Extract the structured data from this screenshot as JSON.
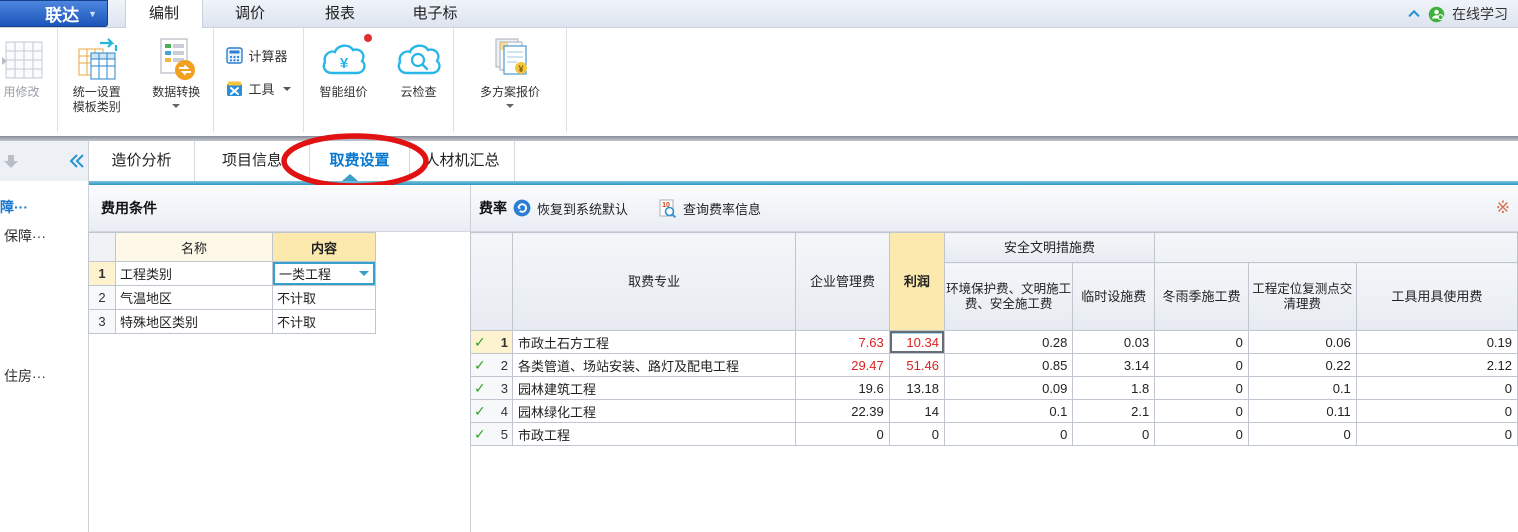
{
  "window": {
    "logo_text": "联达",
    "logo_caret": "▼",
    "menu": [
      {
        "label": "编制",
        "active": true
      },
      {
        "label": "调价"
      },
      {
        "label": "报表"
      },
      {
        "label": "电子标"
      }
    ],
    "online_learning": "在线学习"
  },
  "ribbon": {
    "apply_edit": "用修改",
    "unify_line1": "统一设置",
    "unify_line2": "模板类别",
    "data_convert": "数据转换",
    "calculator": "计算器",
    "tools": "工具",
    "smart_pricing": "智能组价",
    "cloud_check": "云检查",
    "multi_quote": "多方案报价"
  },
  "tabs": {
    "items": [
      {
        "label": "造价分析"
      },
      {
        "label": "项目信息"
      },
      {
        "label": "取费设置",
        "active": true
      },
      {
        "label": "人材机汇总"
      }
    ]
  },
  "sidebar": {
    "items": [
      {
        "label": "障···",
        "active": true
      },
      {
        "label": "保障···"
      },
      {
        "label": "住房···"
      }
    ]
  },
  "cost_conditions": {
    "title": "费用条件",
    "columns": {
      "name": "名称",
      "content": "内容"
    },
    "rows": [
      {
        "num": "1",
        "name": "工程类别",
        "value": "一类工程",
        "editor": "dropdown",
        "selected": true
      },
      {
        "num": "2",
        "name": "气温地区",
        "value": "不计取"
      },
      {
        "num": "3",
        "name": "特殊地区类别",
        "value": "不计取"
      }
    ]
  },
  "rates": {
    "title": "费率",
    "toolbar": {
      "restore": "恢复到系统默认",
      "query": "查询费率信息",
      "corner_icon": "※"
    },
    "check_glyph": "✓",
    "columns": {
      "profession": "取费专业",
      "management": "企业管理费",
      "profit": "利润",
      "safety_group": "安全文明措施费",
      "env_civil": "环境保护费、文明施工费、安全施工费",
      "temp_facility": "临时设施费",
      "winter": "冬雨季施工费",
      "survey_clear": "工程定位复测点交清理费",
      "tool_use": "工具用具使用费"
    },
    "rows": [
      {
        "num": "1",
        "name": "市政土石方工程",
        "values": [
          "7.63",
          "10.34",
          "0.28",
          "0.03",
          "0",
          "0.06",
          "0.19"
        ],
        "red": [
          0,
          1
        ],
        "selected": true,
        "selected_cell": 1
      },
      {
        "num": "2",
        "name": "各类管道、场站安装、路灯及配电工程",
        "values": [
          "29.47",
          "51.46",
          "0.85",
          "3.14",
          "0",
          "0.22",
          "2.12"
        ],
        "red": [
          0,
          1
        ]
      },
      {
        "num": "3",
        "name": "园林建筑工程",
        "values": [
          "19.6",
          "13.18",
          "0.09",
          "1.8",
          "0",
          "0.1",
          "0"
        ],
        "red": []
      },
      {
        "num": "4",
        "name": "园林绿化工程",
        "values": [
          "22.39",
          "14",
          "0.1",
          "2.1",
          "0",
          "0.11",
          "0"
        ],
        "red": []
      },
      {
        "num": "5",
        "name": "市政工程",
        "values": [
          "0",
          "0",
          "0",
          "0",
          "0",
          "0",
          "0"
        ],
        "red": []
      }
    ]
  },
  "colors": {
    "accent_blue": "#0a7ad0",
    "highlight_yellow": "#fce9ae",
    "value_red": "#dd2222",
    "annotation_red": "#e01212",
    "check_green": "#2da32b"
  }
}
